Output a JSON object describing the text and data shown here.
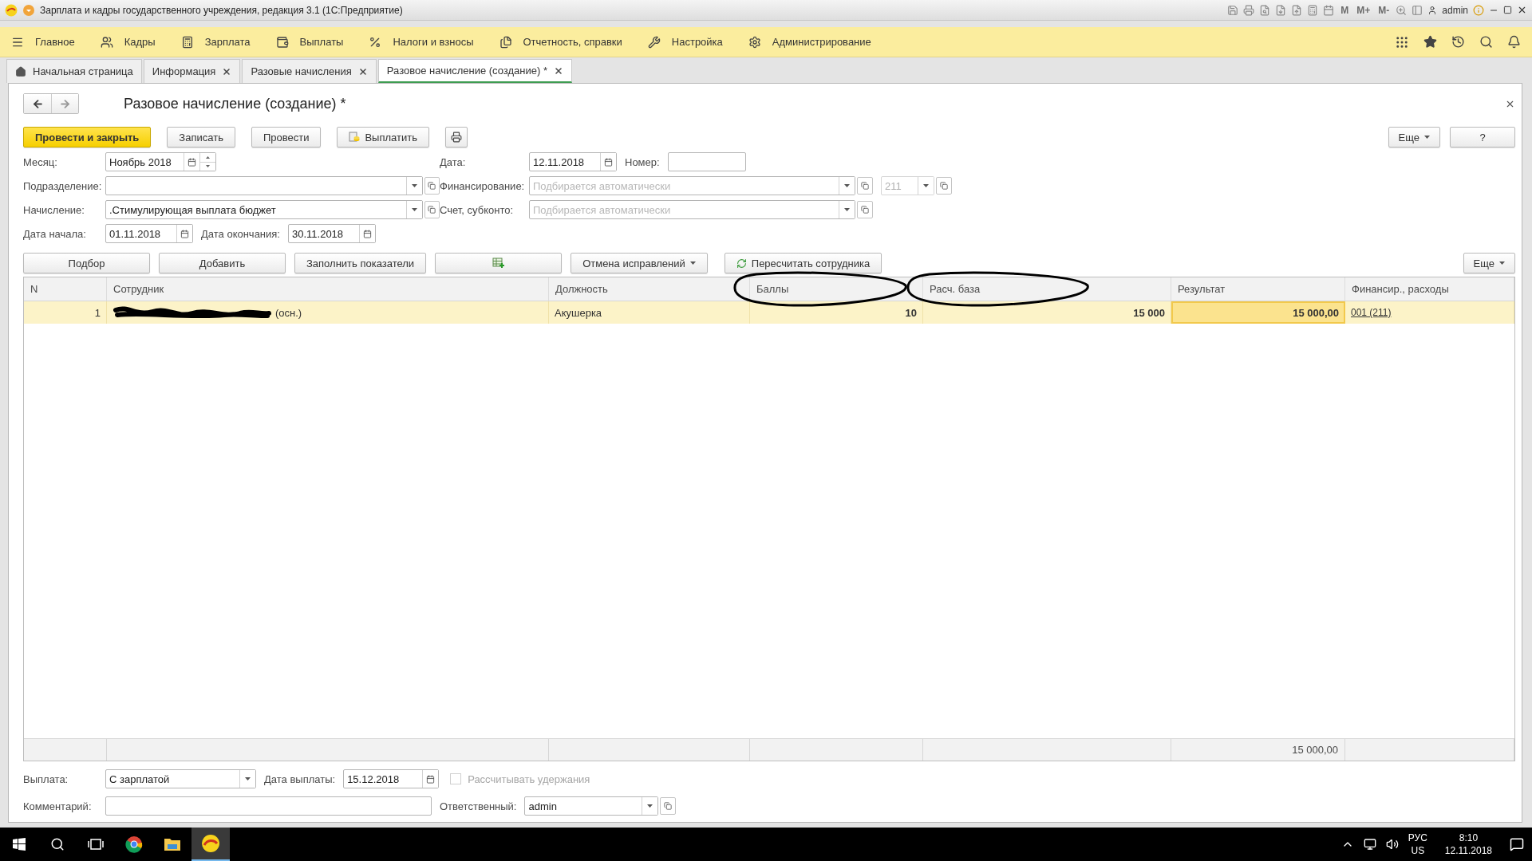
{
  "window": {
    "title": "Зарплата и кадры государственного учреждения, редакция 3.1  (1С:Предприятие)",
    "memory_buttons": [
      "M",
      "M+",
      "M-"
    ],
    "user": "admin"
  },
  "menu": [
    {
      "label": "Главное"
    },
    {
      "label": "Кадры"
    },
    {
      "label": "Зарплата"
    },
    {
      "label": "Выплаты"
    },
    {
      "label": "Налоги и взносы"
    },
    {
      "label": "Отчетность, справки"
    },
    {
      "label": "Настройка"
    },
    {
      "label": "Администрирование"
    }
  ],
  "tabs": [
    {
      "label": "Начальная страница",
      "selected": false,
      "closable": false
    },
    {
      "label": "Информация",
      "selected": false,
      "closable": true
    },
    {
      "label": "Разовые начисления",
      "selected": false,
      "closable": true
    },
    {
      "label": "Разовое начисление (создание) *",
      "selected": true,
      "closable": true
    }
  ],
  "form": {
    "title": "Разовое начисление (создание) *",
    "toolbar": [
      {
        "kind": "primary",
        "label": "Провести и закрыть"
      },
      {
        "kind": "button",
        "label": "Записать"
      },
      {
        "kind": "button",
        "label": "Провести"
      },
      {
        "kind": "pay",
        "label": "Выплатить"
      },
      {
        "kind": "print"
      }
    ],
    "toolbar_right": [
      {
        "kind": "more",
        "label": "Еще"
      },
      {
        "kind": "button",
        "label": "?"
      }
    ],
    "fields": [
      {
        "label": "Месяц:",
        "kind": "month",
        "value": "Ноябрь 2018",
        "disabled": false
      },
      {
        "label": "Дата:",
        "kind": "date",
        "value": "12.11.2018",
        "disabled": false
      },
      {
        "label": "Номер:",
        "kind": "text",
        "disabled": false
      },
      {
        "label": "Подразделение:",
        "kind": "ref",
        "disabled": false
      },
      {
        "label": "Финансирование:",
        "kind": "ref",
        "placeholder": "Подбирается автоматически",
        "disabled": false
      },
      {
        "kind": "ref",
        "value": "211",
        "disabled": true
      },
      {
        "label": "Начисление:",
        "kind": "ref",
        "value": ".Стимулирующая выплата бюджет",
        "disabled": false
      },
      {
        "label": "Счет, субконто:",
        "kind": "ref",
        "placeholder": "Подбирается автоматически",
        "disabled": false
      },
      {
        "label": "Дата начала:",
        "kind": "date",
        "value": "01.11.2018",
        "disabled": false
      },
      {
        "label": "Дата окончания:",
        "kind": "date",
        "value": "30.11.2018",
        "disabled": false
      }
    ]
  },
  "table_toolbar": [
    {
      "kind": "button",
      "label": "Подбор"
    },
    {
      "kind": "button",
      "label": "Добавить"
    },
    {
      "kind": "button",
      "label": "Заполнить показатели"
    },
    {
      "kind": "icon"
    },
    {
      "kind": "menu",
      "label": "Отмена исправлений"
    },
    {
      "kind": "refresh",
      "label": "Пересчитать сотрудника"
    },
    {
      "kind": "more",
      "label": "Еще"
    }
  ],
  "table": {
    "columns": [
      {
        "label": "N",
        "circled": false
      },
      {
        "label": "Сотрудник",
        "circled": false
      },
      {
        "label": "Должность",
        "circled": false
      },
      {
        "label": "Баллы",
        "circled": true
      },
      {
        "label": "Расч. база",
        "circled": true
      },
      {
        "label": "Результат",
        "circled": false
      },
      {
        "label": "Финансир., расходы",
        "circled": false
      }
    ],
    "rows": [
      {
        "selected": true,
        "cells": [
          {
            "text": "1",
            "current": false,
            "redacted": false,
            "link": false
          },
          {
            "text": "(осн.)",
            "current": false,
            "redacted": true,
            "link": false
          },
          {
            "text": "Акушерка",
            "current": false,
            "redacted": false,
            "link": false
          },
          {
            "text": "10",
            "current": false,
            "redacted": false,
            "link": false
          },
          {
            "text": "15 000",
            "current": false,
            "redacted": false,
            "link": false
          },
          {
            "text": "15 000,00",
            "current": true,
            "redacted": false,
            "link": false
          },
          {
            "text": "001 (211)",
            "current": false,
            "redacted": false,
            "link": true
          }
        ]
      }
    ],
    "totals": {
      "result": "15 000,00"
    }
  },
  "footer": {
    "payment": {
      "label": "Выплата:",
      "value": "С зарплатой"
    },
    "payment_date": {
      "label": "Дата выплаты:",
      "value": "15.12.2018"
    },
    "deductions": {
      "label": "Рассчитывать удержания",
      "checked": false,
      "disabled": true
    },
    "comment": {
      "label": "Комментарий:"
    },
    "responsible": {
      "label": "Ответственный:",
      "value": "admin"
    }
  },
  "taskbar": {
    "apps": [
      {
        "selected": false
      },
      {
        "selected": false
      },
      {
        "selected": true
      }
    ],
    "language": "РУС",
    "layout": "US",
    "time": "8:10",
    "date": "12.11.2018"
  }
}
